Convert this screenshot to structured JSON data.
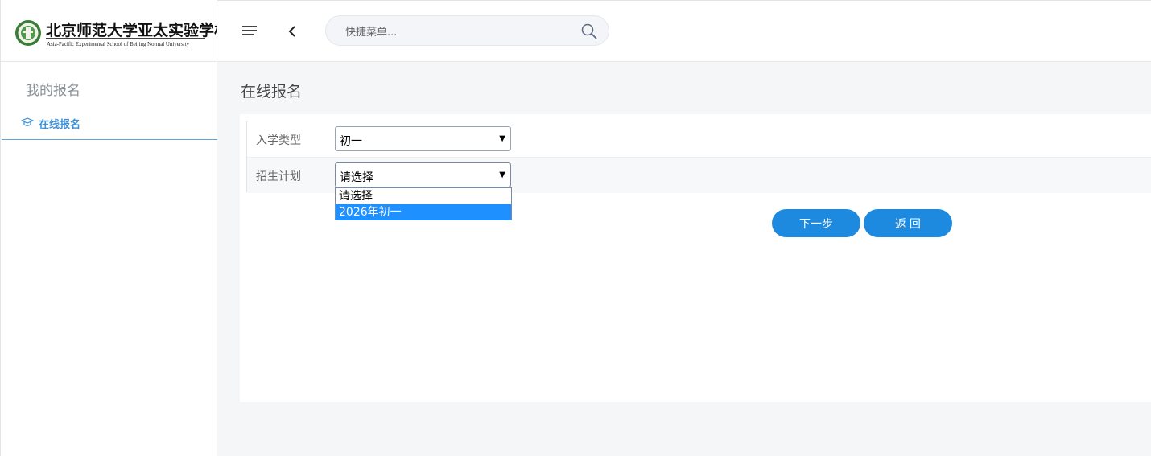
{
  "logo": {
    "name_cn": "北京师范大学亚太实验学校",
    "name_en": "Asia-Pacific Experimental School of Beijing Normal University",
    "icon": "school-emblem-icon"
  },
  "sidebar": {
    "heading": "我的报名",
    "items": [
      {
        "label": "在线报名",
        "icon": "graduation-cap-icon",
        "active": true
      }
    ]
  },
  "header": {
    "menu_icon": "hamburger-menu-icon",
    "back_icon": "chevron-left-icon",
    "search": {
      "placeholder": "快捷菜单...",
      "value": "",
      "icon": "search-icon"
    }
  },
  "main": {
    "title": "在线报名",
    "form": {
      "fields": [
        {
          "label": "入学类型",
          "value": "初一"
        },
        {
          "label": "招生计划",
          "value": "请选择",
          "open": true,
          "options": [
            "请选择",
            "2026年初一"
          ],
          "highlighted": "2026年初一"
        }
      ]
    },
    "buttons": {
      "next": "下一步",
      "back": "返 回"
    }
  },
  "colors": {
    "accent": "#1d8ae0",
    "highlight": "#1e90ff",
    "sidebar_active": "#3e8fd6"
  }
}
